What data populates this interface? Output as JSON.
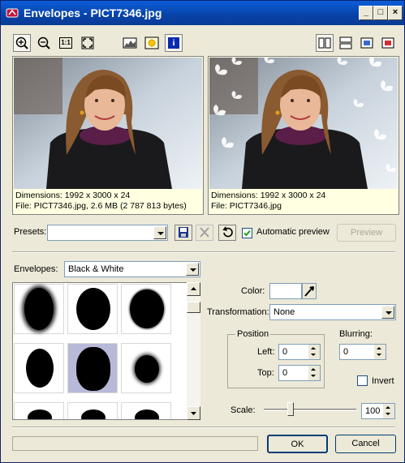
{
  "window": {
    "title": "Envelopes - PICT7346.jpg",
    "min": "_",
    "max": "□",
    "close": "×"
  },
  "toolbar": {
    "icons": [
      "zoom-in-icon",
      "zoom-out-icon",
      "actual-size-icon",
      "fit-window-icon",
      "histogram-icon",
      "sun-icon",
      "info-icon"
    ],
    "actual_size_label": "1:1",
    "info_label": "i"
  },
  "original": {
    "dimensions": "Dimensions: 1992 x 3000 x 24",
    "file": "File: PICT7346.jpg, 2.6 MB (2 787 813 bytes)"
  },
  "result": {
    "dimensions": "Dimensions: 1992 x 3000 x 24",
    "file": "File: PICT7346.jpg"
  },
  "presets": {
    "label": "Presets:",
    "value": "",
    "auto_preview_label": "Automatic preview",
    "auto_preview_checked": true,
    "preview_button": "Preview"
  },
  "envelopes": {
    "label": "Envelopes:",
    "value": "Black & White"
  },
  "color": {
    "label": "Color:",
    "swatch": "#ffffff"
  },
  "transformation": {
    "label": "Transformation:",
    "value": "None"
  },
  "position": {
    "label": "Position",
    "left_label": "Left:",
    "left_value": "0",
    "top_label": "Top:",
    "top_value": "0"
  },
  "blurring": {
    "label": "Blurring:",
    "value": "0"
  },
  "invert": {
    "label": "Invert",
    "checked": false
  },
  "scale": {
    "label": "Scale:",
    "value": "100"
  },
  "buttons": {
    "ok": "OK",
    "cancel": "Cancel"
  }
}
